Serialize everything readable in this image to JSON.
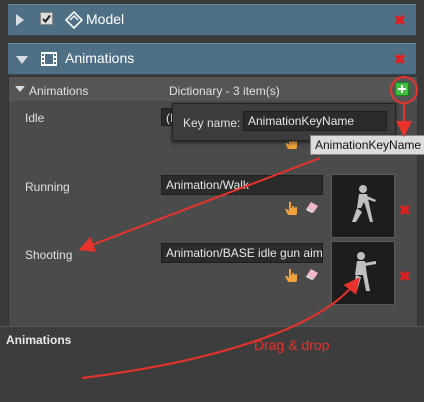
{
  "model_section": {
    "title": "Model",
    "checked": true
  },
  "animations_section": {
    "title": "Animations"
  },
  "dictionary": {
    "label": "Animations",
    "summary": "Dictionary - 3 item(s)",
    "items": [
      {
        "key": "Idle",
        "value": "(N"
      },
      {
        "key": "Running",
        "value": "Animation/Walk"
      },
      {
        "key": "Shooting",
        "value": "Animation/BASE idle gun aim"
      }
    ]
  },
  "key_popup": {
    "label": "Key name:",
    "value": "AnimationKeyName"
  },
  "drag_tooltip": {
    "text": "AnimationKeyName"
  },
  "bottom_panel": {
    "title": "Animations"
  },
  "annotation": {
    "text": "Drag & drop",
    "color": "#e8322b"
  },
  "colors": {
    "section_bar": "#4f6f84",
    "delete": "#e02020",
    "add": "#3fbf3f"
  },
  "icons": [
    "collapse-arrow-icon",
    "checkbox-icon",
    "model-icon",
    "film-icon",
    "delete-icon",
    "add-icon",
    "hand-pointer-icon",
    "eraser-icon"
  ]
}
